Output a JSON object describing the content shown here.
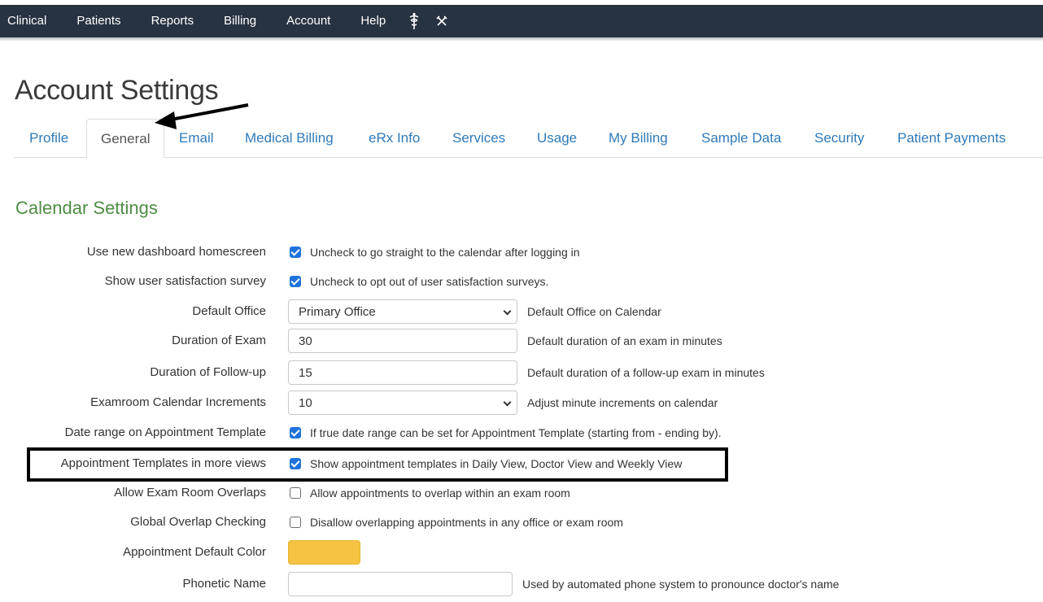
{
  "topnav": {
    "items": [
      "Clinical",
      "Patients",
      "Reports",
      "Billing",
      "Account",
      "Help"
    ],
    "icons": [
      "caduceus-icon",
      "tools-icon"
    ]
  },
  "page": {
    "title": "Account Settings"
  },
  "tabs": [
    {
      "label": "Profile",
      "active": false
    },
    {
      "label": "General",
      "active": true
    },
    {
      "label": "Email",
      "active": false
    },
    {
      "label": "Medical Billing",
      "active": false
    },
    {
      "label": "eRx Info",
      "active": false
    },
    {
      "label": "Services",
      "active": false
    },
    {
      "label": "Usage",
      "active": false
    },
    {
      "label": "My Billing",
      "active": false
    },
    {
      "label": "Sample Data",
      "active": false
    },
    {
      "label": "Security",
      "active": false
    },
    {
      "label": "Patient Payments",
      "active": false
    }
  ],
  "calendar": {
    "title": "Calendar Settings",
    "rows": {
      "dashboard": {
        "label": "Use new dashboard homescreen",
        "checked": true,
        "hint": "Uncheck to go straight to the calendar after logging in"
      },
      "survey": {
        "label": "Show user satisfaction survey",
        "checked": true,
        "hint": "Uncheck to opt out of user satisfaction surveys."
      },
      "office": {
        "label": "Default Office",
        "value": "Primary Office",
        "hint": "Default Office on Calendar"
      },
      "exam_duration": {
        "label": "Duration of Exam",
        "value": "30",
        "hint": "Default duration of an exam in minutes"
      },
      "followup_duration": {
        "label": "Duration of Follow-up",
        "value": "15",
        "hint": "Default duration of a follow-up exam in minutes"
      },
      "increments": {
        "label": "Examroom Calendar Increments",
        "value": "10",
        "hint": "Adjust minute increments on calendar"
      },
      "date_range": {
        "label": "Date range on Appointment Template",
        "checked": true,
        "hint": "If true date range can be set for Appointment Template (starting from - ending by)."
      },
      "templates_views": {
        "label": "Appointment Templates in more views",
        "checked": true,
        "hint": "Show appointment templates in Daily View, Doctor View and Weekly View"
      },
      "overlaps": {
        "label": "Allow Exam Room Overlaps",
        "checked": false,
        "hint": "Allow appointments to overlap within an exam room"
      },
      "global_overlap": {
        "label": "Global Overlap Checking",
        "checked": false,
        "hint": "Disallow overlapping appointments in any office or exam room"
      },
      "default_color": {
        "label": "Appointment Default Color",
        "color": "#f5c242"
      },
      "phonetic": {
        "label": "Phonetic Name",
        "value": "",
        "hint": "Used by automated phone system to pronounce doctor's name"
      }
    }
  },
  "colors": {
    "nav_bg": "#283341",
    "link": "#2f7ab8",
    "section": "#4e8d44",
    "checkbox": "#1f73dc"
  }
}
